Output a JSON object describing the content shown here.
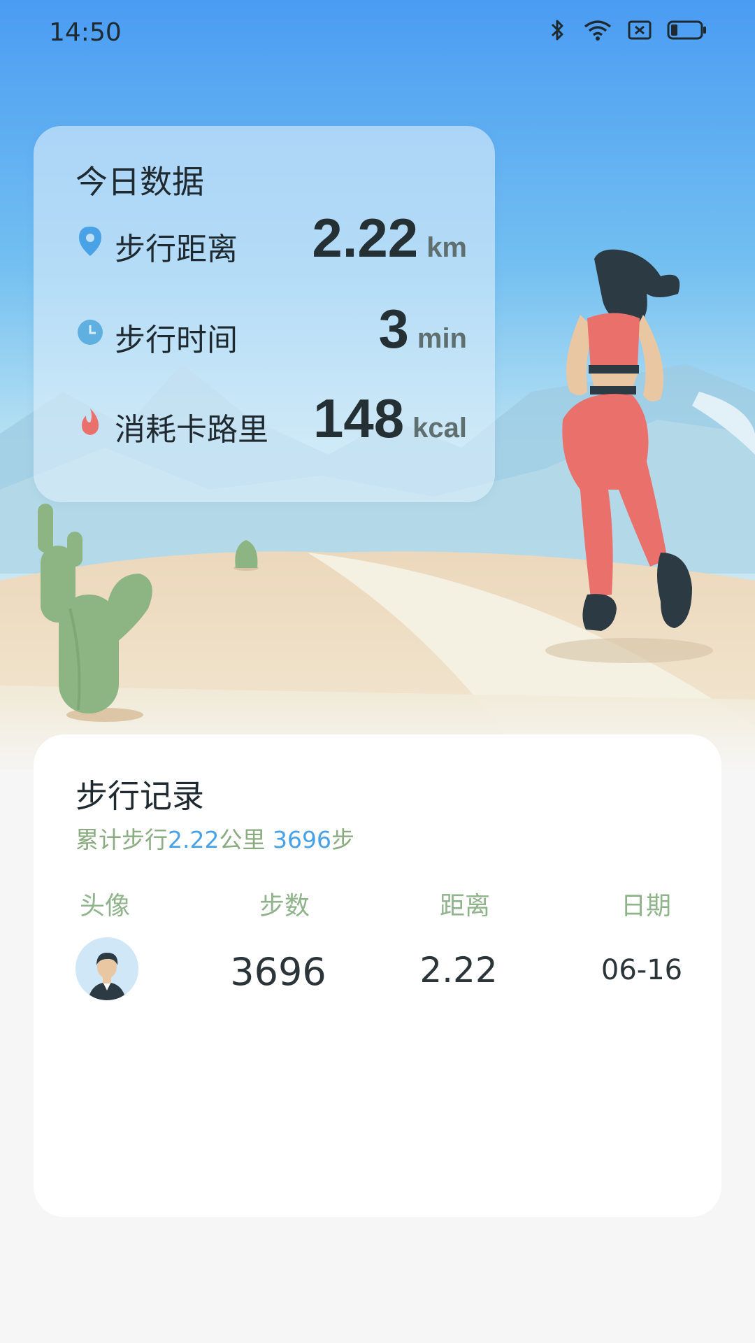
{
  "status_bar": {
    "time": "14:50"
  },
  "today": {
    "title": "今日数据",
    "metrics": [
      {
        "label": "步行距离",
        "value": "2.22",
        "unit": "km",
        "icon": "location-pin-icon"
      },
      {
        "label": "步行时间",
        "value": "3",
        "unit": "min",
        "icon": "clock-icon"
      },
      {
        "label": "消耗卡路里",
        "value": "148",
        "unit": "kcal",
        "icon": "flame-icon"
      }
    ]
  },
  "records": {
    "title": "步行记录",
    "summary": {
      "prefix": "累计步行",
      "distance": "2.22",
      "distance_unit": "公里",
      "steps": "3696",
      "steps_unit": "步"
    },
    "columns": [
      "头像",
      "步数",
      "距离",
      "日期"
    ],
    "rows": [
      {
        "steps": "3696",
        "distance": "2.22",
        "date": "06-16"
      }
    ]
  },
  "colors": {
    "accent": "#4aa2e6",
    "green_text": "#8fb38a",
    "runner_outfit": "#ea716b"
  }
}
